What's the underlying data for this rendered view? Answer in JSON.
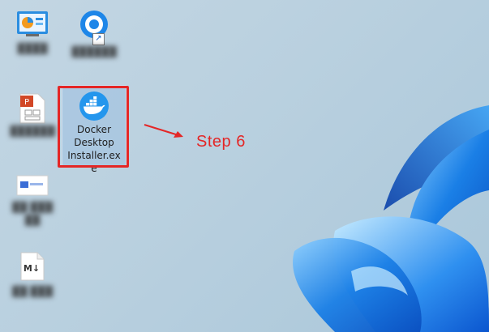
{
  "desktop": {
    "icons": [
      {
        "name": "desktop-icon-1",
        "label": "████"
      },
      {
        "name": "desktop-icon-2",
        "label": "██████"
      },
      {
        "name": "desktop-icon-3",
        "label": "██████"
      },
      {
        "name": "docker",
        "label": "Docker Desktop Installer.exe"
      },
      {
        "name": "desktop-icon-5",
        "label": "██ ███ ██"
      },
      {
        "name": "desktop-icon-6",
        "label": "██ ███"
      }
    ]
  },
  "annotation": {
    "step": "Step 6"
  },
  "colors": {
    "highlight": "#e42626",
    "docker_blue": "#2496ed"
  }
}
